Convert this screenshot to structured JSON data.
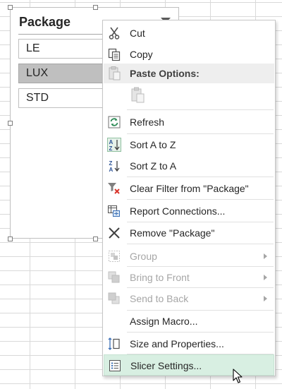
{
  "slicer": {
    "title": "Package",
    "items": [
      {
        "label": "LE",
        "selected": false
      },
      {
        "label": "LUX",
        "selected": true
      },
      {
        "label": "STD",
        "selected": false
      }
    ],
    "filter_icon": "multi-select-filter-icon"
  },
  "context_menu": {
    "paste_options_label": "Paste Options:",
    "items": {
      "cut": {
        "label": "Cut",
        "icon": "scissors-icon",
        "enabled": true
      },
      "copy": {
        "label": "Copy",
        "icon": "copy-icon",
        "enabled": true
      },
      "paste_icon": {
        "icon": "clipboard-paste-icon",
        "enabled": false
      },
      "refresh": {
        "label": "Refresh",
        "icon": "refresh-icon",
        "enabled": true
      },
      "sort_az": {
        "label": "Sort A to Z",
        "icon": "sort-a-z-icon",
        "enabled": true
      },
      "sort_za": {
        "label": "Sort Z to A",
        "icon": "sort-z-a-icon",
        "enabled": true
      },
      "clear_filter": {
        "label": "Clear Filter from \"Package\"",
        "icon": "clear-filter-icon",
        "enabled": true
      },
      "report_connections": {
        "label": "Report Connections...",
        "icon": "report-connections-icon",
        "enabled": true
      },
      "remove": {
        "label": "Remove \"Package\"",
        "icon": "remove-x-icon",
        "enabled": true
      },
      "group": {
        "label": "Group",
        "icon": "group-icon",
        "enabled": false,
        "submenu": true
      },
      "bring_to_front": {
        "label": "Bring to Front",
        "icon": "bring-to-front-icon",
        "enabled": false,
        "submenu": true
      },
      "send_to_back": {
        "label": "Send to Back",
        "icon": "send-to-back-icon",
        "enabled": false,
        "submenu": true
      },
      "assign_macro": {
        "label": "Assign Macro...",
        "enabled": true
      },
      "size_properties": {
        "label": "Size and Properties...",
        "icon": "size-properties-icon",
        "enabled": true
      },
      "slicer_settings": {
        "label": "Slicer Settings...",
        "icon": "slicer-settings-icon",
        "enabled": true,
        "highlighted": true
      }
    }
  },
  "colors": {
    "highlight": "#d8efe2",
    "selected_item": "#bfbfbf",
    "disabled_text": "#a6a6a6",
    "gridline": "#d9d9d9"
  }
}
